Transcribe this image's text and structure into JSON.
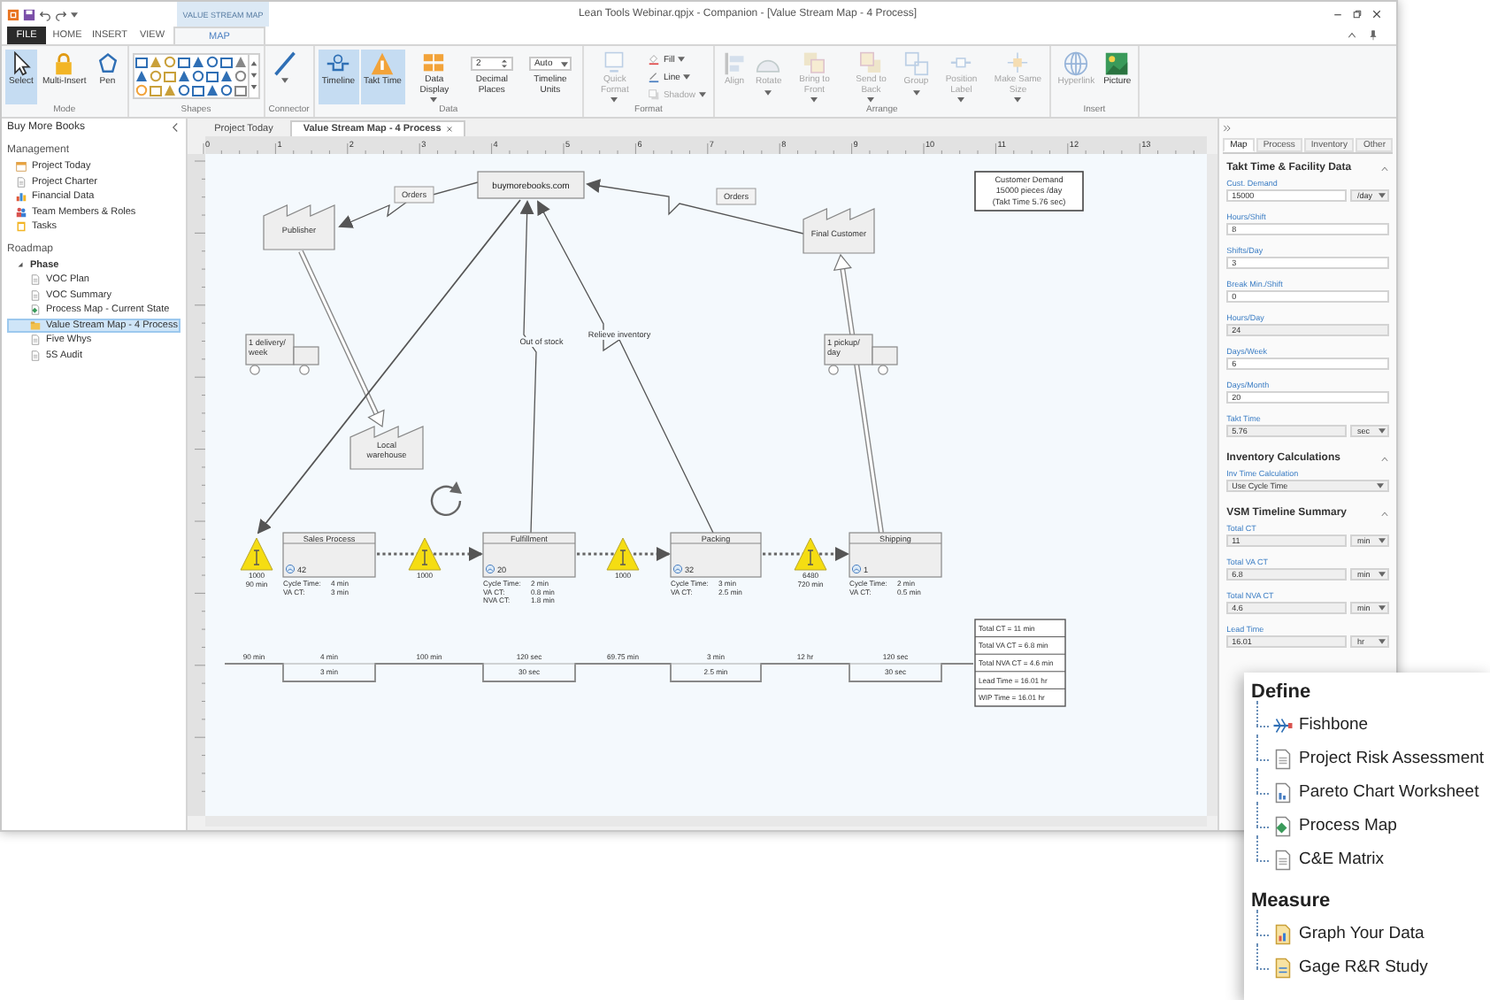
{
  "window": {
    "title": "Lean Tools Webinar.qpjx - Companion - [Value Stream Map - 4 Process]",
    "context_label": "VALUE STREAM MAP"
  },
  "ribbon_tabs": [
    {
      "label": "FILE",
      "kind": "file",
      "selected": false
    },
    {
      "label": "HOME",
      "kind": "tab",
      "selected": false
    },
    {
      "label": "INSERT",
      "kind": "tab",
      "selected": false
    },
    {
      "label": "VIEW",
      "kind": "tab",
      "selected": false
    },
    {
      "label": "MAP",
      "kind": "context",
      "selected": true
    }
  ],
  "ribbon_groups": [
    {
      "label": "Mode",
      "items": [
        {
          "kind": "large",
          "label": "Select",
          "selected": true,
          "disabled": false,
          "menu": false
        },
        {
          "kind": "large",
          "label": "Multi-Insert",
          "selected": false,
          "disabled": false,
          "menu": false
        },
        {
          "kind": "large",
          "label": "Pen",
          "selected": false,
          "disabled": false,
          "menu": false
        }
      ]
    },
    {
      "label": "Shapes",
      "items": [
        {
          "kind": "gallery"
        }
      ]
    },
    {
      "label": "Connector",
      "items": [
        {
          "kind": "large",
          "selected": false,
          "disabled": false,
          "menu": true
        }
      ]
    },
    {
      "label": "Data",
      "items": [
        {
          "kind": "large",
          "label": "Timeline",
          "selected": true,
          "disabled": false,
          "menu": false
        },
        {
          "kind": "large",
          "label": "Takt Time",
          "selected": true,
          "disabled": false,
          "menu": false
        },
        {
          "kind": "large",
          "label": "Data Display",
          "selected": false,
          "disabled": false,
          "menu": true
        },
        {
          "kind": "spinner",
          "value": "2",
          "label": "Decimal Places"
        },
        {
          "kind": "dropdown",
          "value": "Auto",
          "label": "Timeline Units"
        }
      ]
    },
    {
      "label": "Format",
      "items": [
        {
          "kind": "large",
          "label": "Quick Format",
          "selected": false,
          "disabled": true,
          "menu": true
        },
        {
          "kind": "small",
          "label": "Fill",
          "selected": false,
          "disabled": false,
          "menu": true
        },
        {
          "kind": "small",
          "label": "Line",
          "selected": false,
          "disabled": false,
          "menu": true
        },
        {
          "kind": "small",
          "label": "Shadow",
          "selected": false,
          "disabled": true,
          "menu": true
        }
      ]
    },
    {
      "label": "Arrange",
      "items": [
        {
          "kind": "large",
          "label": "Align",
          "selected": false,
          "disabled": true,
          "menu": false
        },
        {
          "kind": "large",
          "label": "Rotate",
          "selected": false,
          "disabled": true,
          "menu": true
        },
        {
          "kind": "large",
          "label": "Bring to Front",
          "selected": false,
          "disabled": true,
          "menu": true
        },
        {
          "kind": "large",
          "label": "Send to Back",
          "selected": false,
          "disabled": true,
          "menu": true
        },
        {
          "kind": "large",
          "label": "Group",
          "selected": false,
          "disabled": true,
          "menu": true
        },
        {
          "kind": "large",
          "label": "Position Label",
          "selected": false,
          "disabled": true,
          "menu": true
        },
        {
          "kind": "large",
          "label": "Make Same Size",
          "selected": false,
          "disabled": true,
          "menu": true
        }
      ]
    },
    {
      "label": "Insert",
      "items": [
        {
          "kind": "large",
          "label": "Hyperlink",
          "selected": false,
          "disabled": true,
          "menu": false
        },
        {
          "kind": "large",
          "label": "Picture",
          "selected": false,
          "disabled": false,
          "menu": false
        }
      ]
    }
  ],
  "sidebar": {
    "title": "Buy More Books",
    "sections": [
      {
        "title": "Management",
        "items": [
          {
            "label": "Project Today",
            "selected": false
          },
          {
            "label": "Project Charter",
            "selected": false
          },
          {
            "label": "Financial Data",
            "selected": false
          },
          {
            "label": "Team Members & Roles",
            "selected": false
          },
          {
            "label": "Tasks",
            "selected": false
          }
        ]
      },
      {
        "title": "Roadmap",
        "items": [
          {
            "label": "Phase",
            "selected": false,
            "expanded": true,
            "children": [
              {
                "label": "VOC Plan",
                "selected": false
              },
              {
                "label": "VOC Summary",
                "selected": false
              },
              {
                "label": "Process Map - Current State",
                "selected": false
              },
              {
                "label": "Value Stream Map - 4 Process",
                "selected": true
              },
              {
                "label": "Five Whys",
                "selected": false
              },
              {
                "label": "5S Audit",
                "selected": false
              }
            ]
          }
        ]
      }
    ]
  },
  "doc_tabs": [
    {
      "label": "Project Today",
      "selected": false,
      "closable": false
    },
    {
      "label": "Value Stream Map - 4 Process",
      "selected": true,
      "closable": true
    }
  ],
  "canvas": {
    "ruler_labels": [
      "0",
      "1",
      "2",
      "3",
      "4",
      "5",
      "6",
      "7",
      "8",
      "9",
      "10",
      "11",
      "12",
      "13"
    ],
    "nodes": [
      {
        "kind": "factory",
        "lines": [
          "Publisher"
        ]
      },
      {
        "kind": "box",
        "lines": [
          "buymorebooks.com"
        ]
      },
      {
        "kind": "factory",
        "lines": [
          "Final Customer"
        ]
      },
      {
        "kind": "factory",
        "lines": [
          "Local",
          "warehouse"
        ]
      },
      {
        "kind": "note",
        "lines": [
          "Customer Demand",
          "15000 pieces /day",
          "(Takt Time 5.76 sec)"
        ]
      },
      {
        "kind": "truck",
        "lines": [
          "1 delivery/",
          "week"
        ]
      },
      {
        "kind": "truck",
        "lines": [
          "1 pickup/",
          "day"
        ]
      }
    ],
    "info_flows": [
      {
        "kind": "electronic",
        "label": "Orders",
        "boxed": true
      },
      {
        "kind": "electronic",
        "label": "Orders",
        "boxed": true
      },
      {
        "kind": "electronic",
        "label": "Out of stock",
        "boxed": false
      },
      {
        "kind": "electronic",
        "label": "Relieve inventory",
        "boxed": false
      },
      {
        "kind": "manual"
      }
    ],
    "processes": [
      {
        "name": "Sales Process",
        "operators": "42",
        "metrics": [
          {
            "label": "Cycle Time:",
            "value": "4 min"
          },
          {
            "label": "VA CT:",
            "value": "3 min"
          }
        ]
      },
      {
        "name": "Fulfillment",
        "operators": "20",
        "metrics": [
          {
            "label": "Cycle Time:",
            "value": "2 min"
          },
          {
            "label": "VA CT:",
            "value": "0.8 min"
          },
          {
            "label": "NVA CT:",
            "value": "1.8 min"
          }
        ]
      },
      {
        "name": "Packing",
        "operators": "32",
        "metrics": [
          {
            "label": "Cycle Time:",
            "value": "3 min"
          },
          {
            "label": "VA CT:",
            "value": "2.5 min"
          }
        ]
      },
      {
        "name": "Shipping",
        "operators": "1",
        "metrics": [
          {
            "label": "Cycle Time:",
            "value": "2 min"
          },
          {
            "label": "VA CT:",
            "value": "0.5 min"
          }
        ]
      }
    ],
    "inventories": [
      {
        "quantity": "1000",
        "time": "90 min"
      },
      {
        "quantity": "1000"
      },
      {
        "quantity": "1000"
      },
      {
        "quantity": "6480",
        "time": "720 min"
      }
    ],
    "timeline": [
      {
        "kind": "wait",
        "value": "90 min"
      },
      {
        "kind": "process",
        "top": "4 min",
        "bottom": "3 min"
      },
      {
        "kind": "wait",
        "value": "100 min"
      },
      {
        "kind": "process",
        "top": "120 sec",
        "bottom": "30 sec"
      },
      {
        "kind": "wait",
        "value": "69.75 min"
      },
      {
        "kind": "process",
        "top": "3 min",
        "bottom": "2.5 min"
      },
      {
        "kind": "wait",
        "value": "12 hr"
      },
      {
        "kind": "process",
        "top": "120 sec",
        "bottom": "30 sec"
      }
    ],
    "totals": [
      "Total CT = 11 min",
      "Total VA CT = 6.8 min",
      "Total NVA CT = 4.6 min",
      "Lead Time = 16.01 hr",
      "WIP Time = 16.01 hr"
    ]
  },
  "panel": {
    "tabs": [
      {
        "label": "Map",
        "selected": true
      },
      {
        "label": "Process",
        "selected": false
      },
      {
        "label": "Inventory",
        "selected": false
      },
      {
        "label": "Other",
        "selected": false
      }
    ],
    "sections": [
      {
        "title": "Takt Time & Facility Data",
        "expanded": true,
        "fields": [
          {
            "kind": "text",
            "label": "Cust. Demand",
            "value": "15000",
            "unit": "/day",
            "readonly": false
          },
          {
            "kind": "text",
            "label": "Hours/Shift",
            "value": "8",
            "readonly": false
          },
          {
            "kind": "text",
            "label": "Shifts/Day",
            "value": "3",
            "readonly": false
          },
          {
            "kind": "text",
            "label": "Break Min./Shift",
            "value": "0",
            "readonly": false
          },
          {
            "kind": "text",
            "label": "Hours/Day",
            "value": "24",
            "readonly": true
          },
          {
            "kind": "text",
            "label": "Days/Week",
            "value": "6",
            "readonly": false
          },
          {
            "kind": "text",
            "label": "Days/Month",
            "value": "20",
            "readonly": false
          },
          {
            "kind": "text",
            "label": "Takt Time",
            "value": "5.76",
            "unit": "sec",
            "readonly": true
          }
        ]
      },
      {
        "title": "Inventory Calculations",
        "expanded": true,
        "fields": [
          {
            "kind": "select",
            "label": "Inv Time Calculation",
            "value": "Use Cycle Time"
          }
        ]
      },
      {
        "title": "VSM Timeline Summary",
        "expanded": true,
        "fields": [
          {
            "kind": "text",
            "label": "Total CT",
            "value": "11",
            "unit": "min",
            "readonly": true
          },
          {
            "kind": "text",
            "label": "Total VA CT",
            "value": "6.8",
            "unit": "min",
            "readonly": true
          },
          {
            "kind": "text",
            "label": "Total NVA CT",
            "value": "4.6",
            "unit": "min",
            "readonly": true
          },
          {
            "kind": "text",
            "label": "Lead Time",
            "value": "16.01",
            "unit": "hr",
            "readonly": true
          }
        ]
      }
    ]
  },
  "callout": {
    "groups": [
      {
        "title": "Define",
        "items": [
          "Fishbone",
          "Project Risk Assessment",
          "Pareto Chart Worksheet",
          "Process Map",
          "C&E Matrix"
        ]
      },
      {
        "title": "Measure",
        "items": [
          "Graph Your Data",
          "Gage R&R Study"
        ]
      }
    ]
  }
}
